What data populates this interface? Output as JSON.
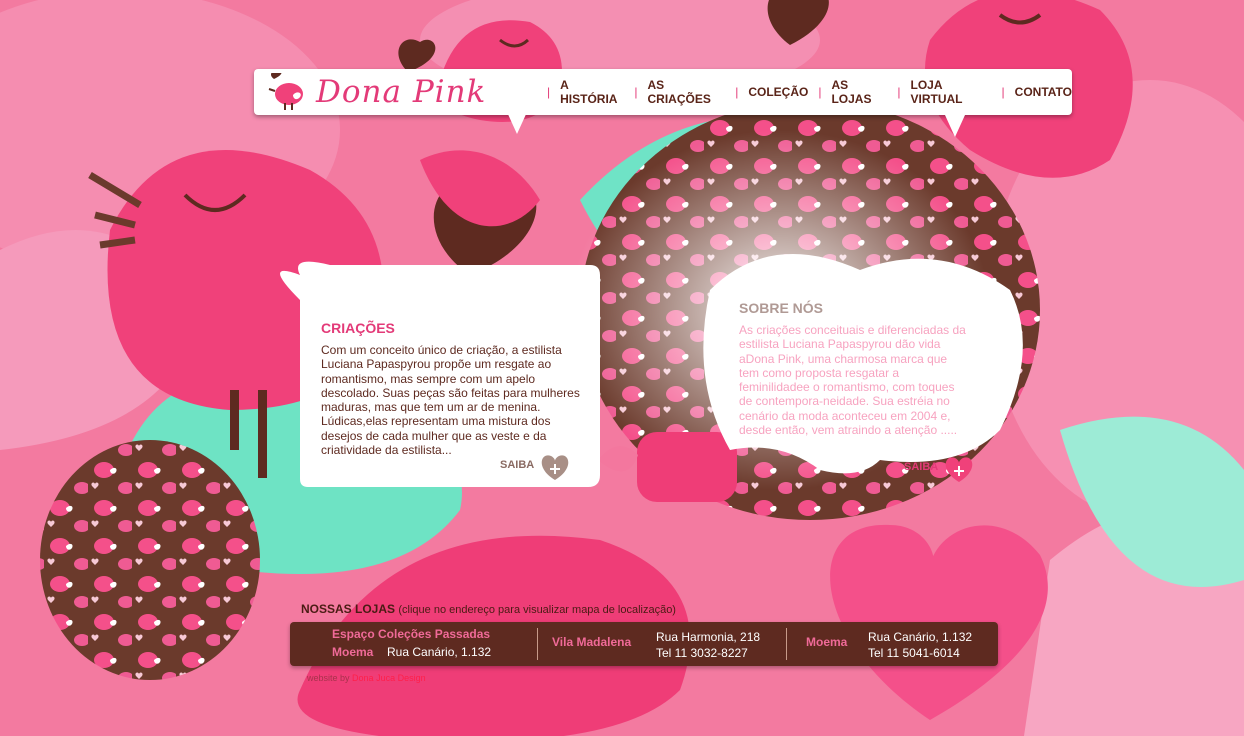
{
  "brand": {
    "name": "Dona Pink"
  },
  "nav": {
    "items": [
      "A HISTÓRIA",
      "AS CRIAÇÕES",
      "COLEÇÃO",
      "AS LOJAS",
      "LOJA VIRTUAL",
      "CONTATO"
    ],
    "separator": "|"
  },
  "criacoes": {
    "title": "CRIAÇÕES",
    "body": "Com um conceito único de criação, a estilista Luciana Papaspyrou propõe um resgate ao romantismo, mas sempre com um apelo descolado. Suas peças são feitas para mulheres maduras, mas que tem um ar de menina. Lúdicas,elas representam uma mistura dos desejos de cada mulher que as veste e da criatividade da estilista...",
    "more": "SAIBA"
  },
  "sobre": {
    "title": "SOBRE NÓS",
    "body": "As criações conceituais e diferenciadas da estilista Luciana Papaspyrou dão vida aDona Pink, uma charmosa marca que tem como proposta resgatar a feminilidadee o romantismo, com toques de contempora-neidade. Sua estréia no cenário da moda aconteceu em 2004 e, desde então, vem atraindo a atenção .....",
    "more": "SAIBA"
  },
  "stores": {
    "title": "NOSSAS LOJAS",
    "hint": "(clique no endereço para visualizar mapa de localização)",
    "list": [
      {
        "name": "Espaço Coleções Passadas",
        "sub": "Moema",
        "address": "Rua Canário, 1.132"
      },
      {
        "name": "Vila Madalena",
        "address": "Rua Harmonia, 218",
        "phone": "Tel 11 3032-8227"
      },
      {
        "name": "Moema",
        "address": "Rua Canário, 1.132",
        "phone": "Tel 11 5041-6014"
      }
    ]
  },
  "credit": {
    "prefix": "website by",
    "author": "Dona Juca Design"
  },
  "colors": {
    "pink": "#f0417a",
    "brown": "#5e2a20",
    "mint": "#6ee3c4",
    "background": "#f37aa0"
  }
}
